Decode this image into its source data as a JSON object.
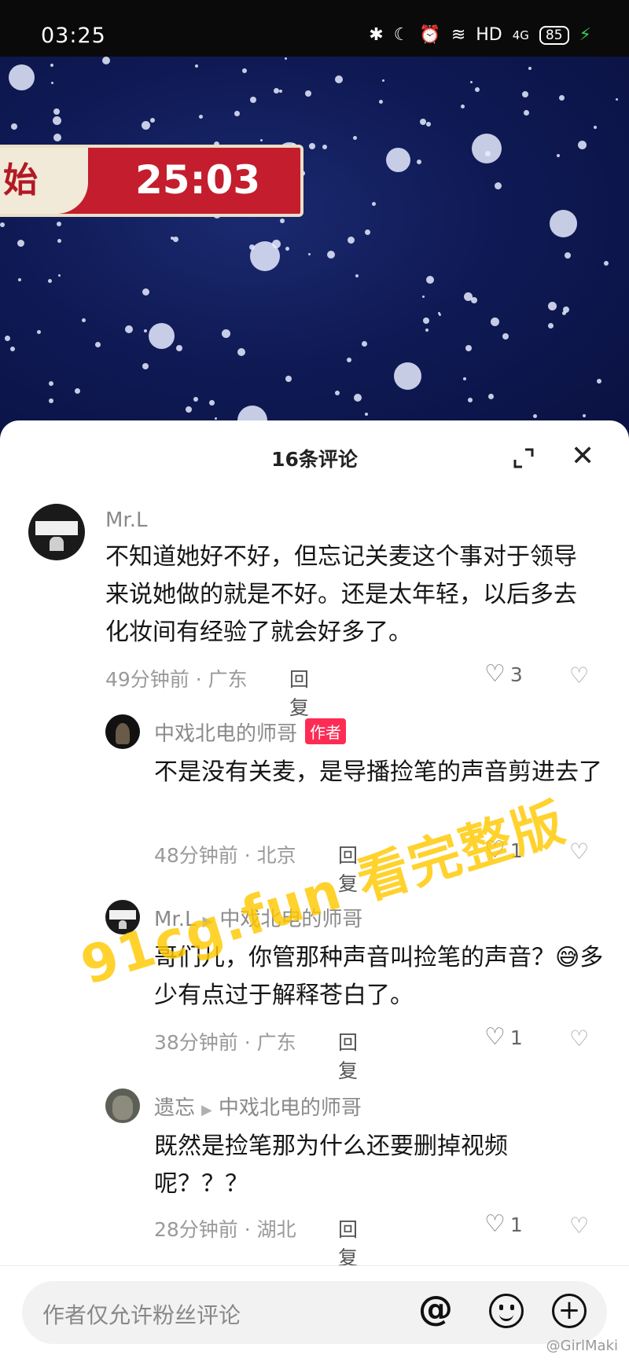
{
  "status_bar": {
    "time": "03:25",
    "network": "HD",
    "signal": "4G",
    "battery": "85"
  },
  "video": {
    "banner_char": "始",
    "timer": "25:03"
  },
  "sheet": {
    "title": "16条评论"
  },
  "comments": [
    {
      "user": "Mr.L",
      "text": "不知道她好不好，但忘记关麦这个事对于领导来说她做的就是不好。还是太年轻，以后多去化妆间有经验了就会好多了。",
      "meta": "49分钟前 · 广东",
      "reply": "回复",
      "likes": "3"
    },
    {
      "user": "中戏北电的师哥",
      "badge": "作者",
      "text": "不是没有关麦，是导播捡笔的声音剪进去了",
      "meta": "48分钟前 · 北京",
      "reply": "回复",
      "likes": "1"
    },
    {
      "user": "Mr.L",
      "reply_to": "中戏北电的师哥",
      "text": "哥们儿，你管那种声音叫捡笔的声音？😅多少有点过于解释苍白了。",
      "meta": "38分钟前 · 广东",
      "reply": "回复",
      "likes": "1"
    },
    {
      "user": "遗忘",
      "reply_to": "中戏北电的师哥",
      "text": "既然是捡笔那为什么还要删掉视频呢？？？",
      "meta": "28分钟前 · 湖北",
      "reply": "回复",
      "likes": "1"
    }
  ],
  "input": {
    "placeholder": "作者仅允许粉丝评论"
  },
  "watermark": "91cg.fun 看完整版",
  "weibo_mark": "@GirlMaki",
  "icons": [
    "bluetooth-icon",
    "moon-icon",
    "alarm-icon",
    "wifi-icon",
    "expand-icon",
    "close-icon",
    "heart-icon",
    "broken-heart-icon",
    "at-icon",
    "emoji-icon",
    "plus-icon"
  ]
}
